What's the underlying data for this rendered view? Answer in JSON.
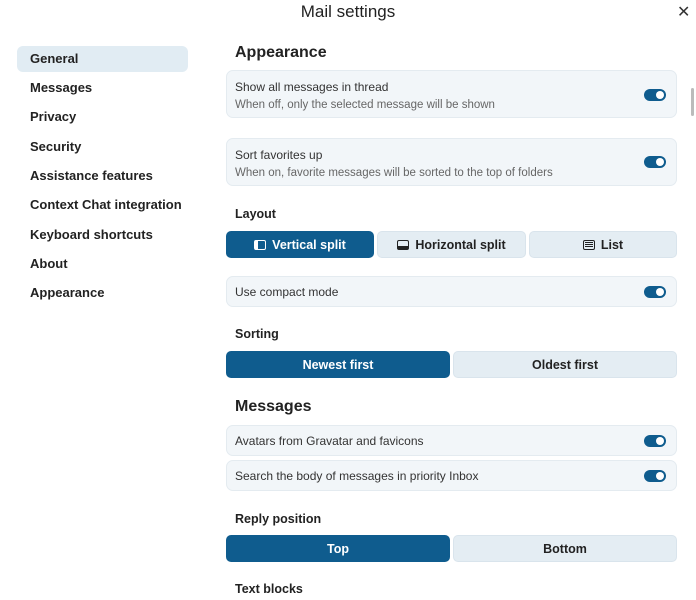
{
  "title": "Mail settings",
  "sidebar": {
    "items": [
      {
        "label": "General"
      },
      {
        "label": "Messages"
      },
      {
        "label": "Privacy"
      },
      {
        "label": "Security"
      },
      {
        "label": "Assistance features"
      },
      {
        "label": "Context Chat integration"
      },
      {
        "label": "Keyboard shortcuts"
      },
      {
        "label": "About"
      },
      {
        "label": "Appearance"
      }
    ],
    "active": "General"
  },
  "appearance": {
    "heading": "Appearance",
    "show_thread": {
      "title": "Show all messages in thread",
      "desc": "When off, only the selected message will be shown",
      "on": true
    },
    "sort_fav": {
      "title": "Sort favorites up",
      "desc": "When on, favorite messages will be sorted to the top of folders",
      "on": true
    },
    "layout": {
      "label": "Layout",
      "options": [
        "Vertical split",
        "Horizontal split",
        "List"
      ],
      "selected": "Vertical split"
    },
    "compact": {
      "title": "Use compact mode",
      "on": true
    },
    "sorting": {
      "label": "Sorting",
      "options": [
        "Newest first",
        "Oldest first"
      ],
      "selected": "Newest first"
    }
  },
  "messages": {
    "heading": "Messages",
    "gravatar": {
      "title": "Avatars from Gravatar and favicons",
      "on": true
    },
    "search_body": {
      "title": "Search the body of messages in priority Inbox",
      "on": true
    },
    "reply": {
      "label": "Reply position",
      "options": [
        "Top",
        "Bottom"
      ],
      "selected": "Top"
    },
    "text_blocks": {
      "label": "Text blocks"
    }
  },
  "colors": {
    "primary": "#0f5c8e",
    "card": "#f2f6f9"
  }
}
